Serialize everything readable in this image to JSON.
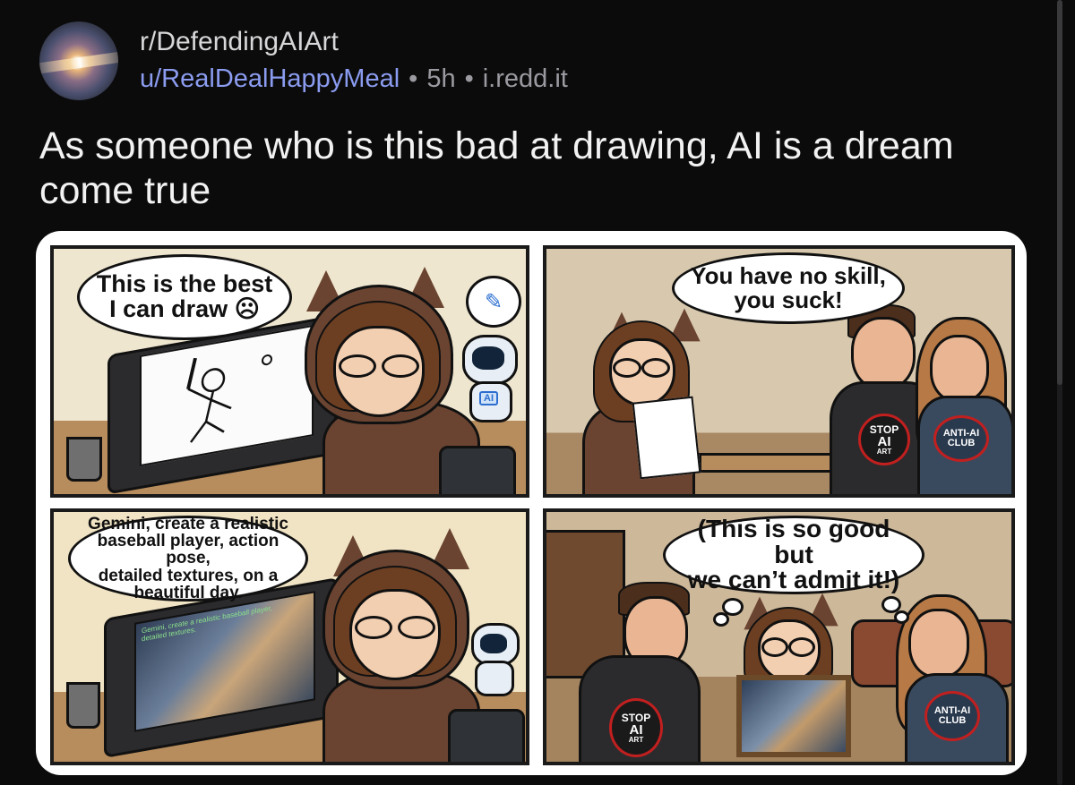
{
  "post": {
    "subreddit": "r/DefendingAIArt",
    "author": "u/RealDealHappyMeal",
    "age": "5h",
    "domain": "i.redd.it",
    "separator": "•",
    "title": "As someone who is this bad at drawing, AI is a dream come true"
  },
  "comic": {
    "panel1": {
      "speech": "This is the best\nI can draw ☹",
      "robot_label": "AI",
      "pen_icon": "✎"
    },
    "panel2": {
      "speech": "You have no skill,\nyou suck!",
      "shirt_stop": [
        "STOP",
        "AI",
        "ART"
      ],
      "shirt_anti": [
        "ANTI-AI",
        "CLUB"
      ]
    },
    "panel3": {
      "speech": "Gemini, create a realistic\nbaseball player, action pose,\ndetailed textures, on a\nbeautiful day.",
      "screen_text": "Gemini, create a realistic baseball player,\ndetailed textures."
    },
    "panel4": {
      "thought": "(This is so good but\nwe can’t admit it!)",
      "shirt_stop": [
        "STOP",
        "AI",
        "ART"
      ],
      "shirt_anti": [
        "ANTI-AI",
        "CLUB"
      ]
    }
  },
  "colors": {
    "background": "#0b0b0c",
    "username": "#8b9cf0",
    "meta": "#9a9aa0",
    "badge_red": "#c21f1f"
  }
}
